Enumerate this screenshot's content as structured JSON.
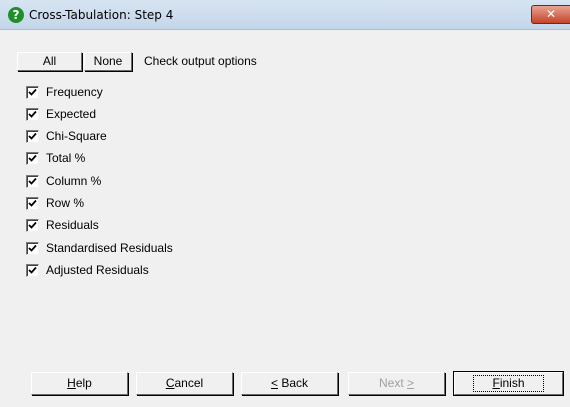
{
  "window": {
    "title": "Cross-Tabulation: Step 4",
    "close_glyph": "✕",
    "help_glyph": "?"
  },
  "toolbar": {
    "all_label": "All",
    "none_label": "None",
    "options_label": "Check output options"
  },
  "options": [
    {
      "label": "Frequency",
      "checked": true
    },
    {
      "label": "Expected",
      "checked": true
    },
    {
      "label": "Chi-Square",
      "checked": true
    },
    {
      "label": "Total %",
      "checked": true
    },
    {
      "label": "Column %",
      "checked": true
    },
    {
      "label": "Row %",
      "checked": true
    },
    {
      "label": "Residuals",
      "checked": true
    },
    {
      "label": "Standardised Residuals",
      "checked": true
    },
    {
      "label": "Adjusted Residuals",
      "checked": true
    }
  ],
  "buttons": {
    "help": {
      "pre": "",
      "mnemonic": "H",
      "post": "elp"
    },
    "cancel": {
      "pre": "",
      "mnemonic": "C",
      "post": "ancel"
    },
    "back": {
      "pre": "",
      "mnemonic": "<",
      "post": " Back"
    },
    "next": {
      "pre": "Next ",
      "mnemonic": ">",
      "post": ""
    },
    "finish": {
      "pre": "",
      "mnemonic": "F",
      "post": "inish"
    }
  },
  "colors": {
    "client_bg": "#f0f0f0",
    "title_bg": "#c4d6ea",
    "close_bg": "#c5432a",
    "help_icon": "#1f8f2a"
  }
}
